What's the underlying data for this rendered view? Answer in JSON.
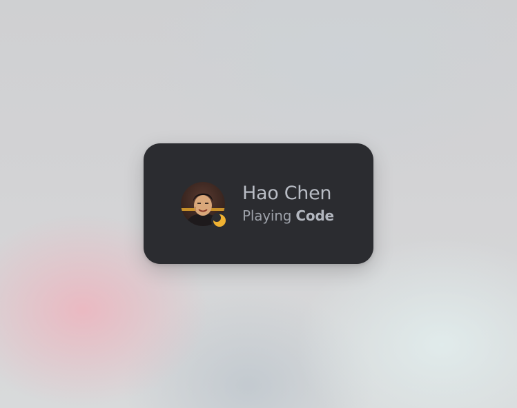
{
  "user": {
    "name": "Hao Chen",
    "avatar_icon": "user-avatar-photo",
    "status": "idle",
    "status_icon": "crescent-moon-icon",
    "status_color": "#f0b232"
  },
  "activity": {
    "verb": "Playing",
    "game": "Code"
  },
  "colors": {
    "card_background": "#2b2c30",
    "name_text": "#b8bcc4",
    "activity_text": "#9ea2aa"
  }
}
